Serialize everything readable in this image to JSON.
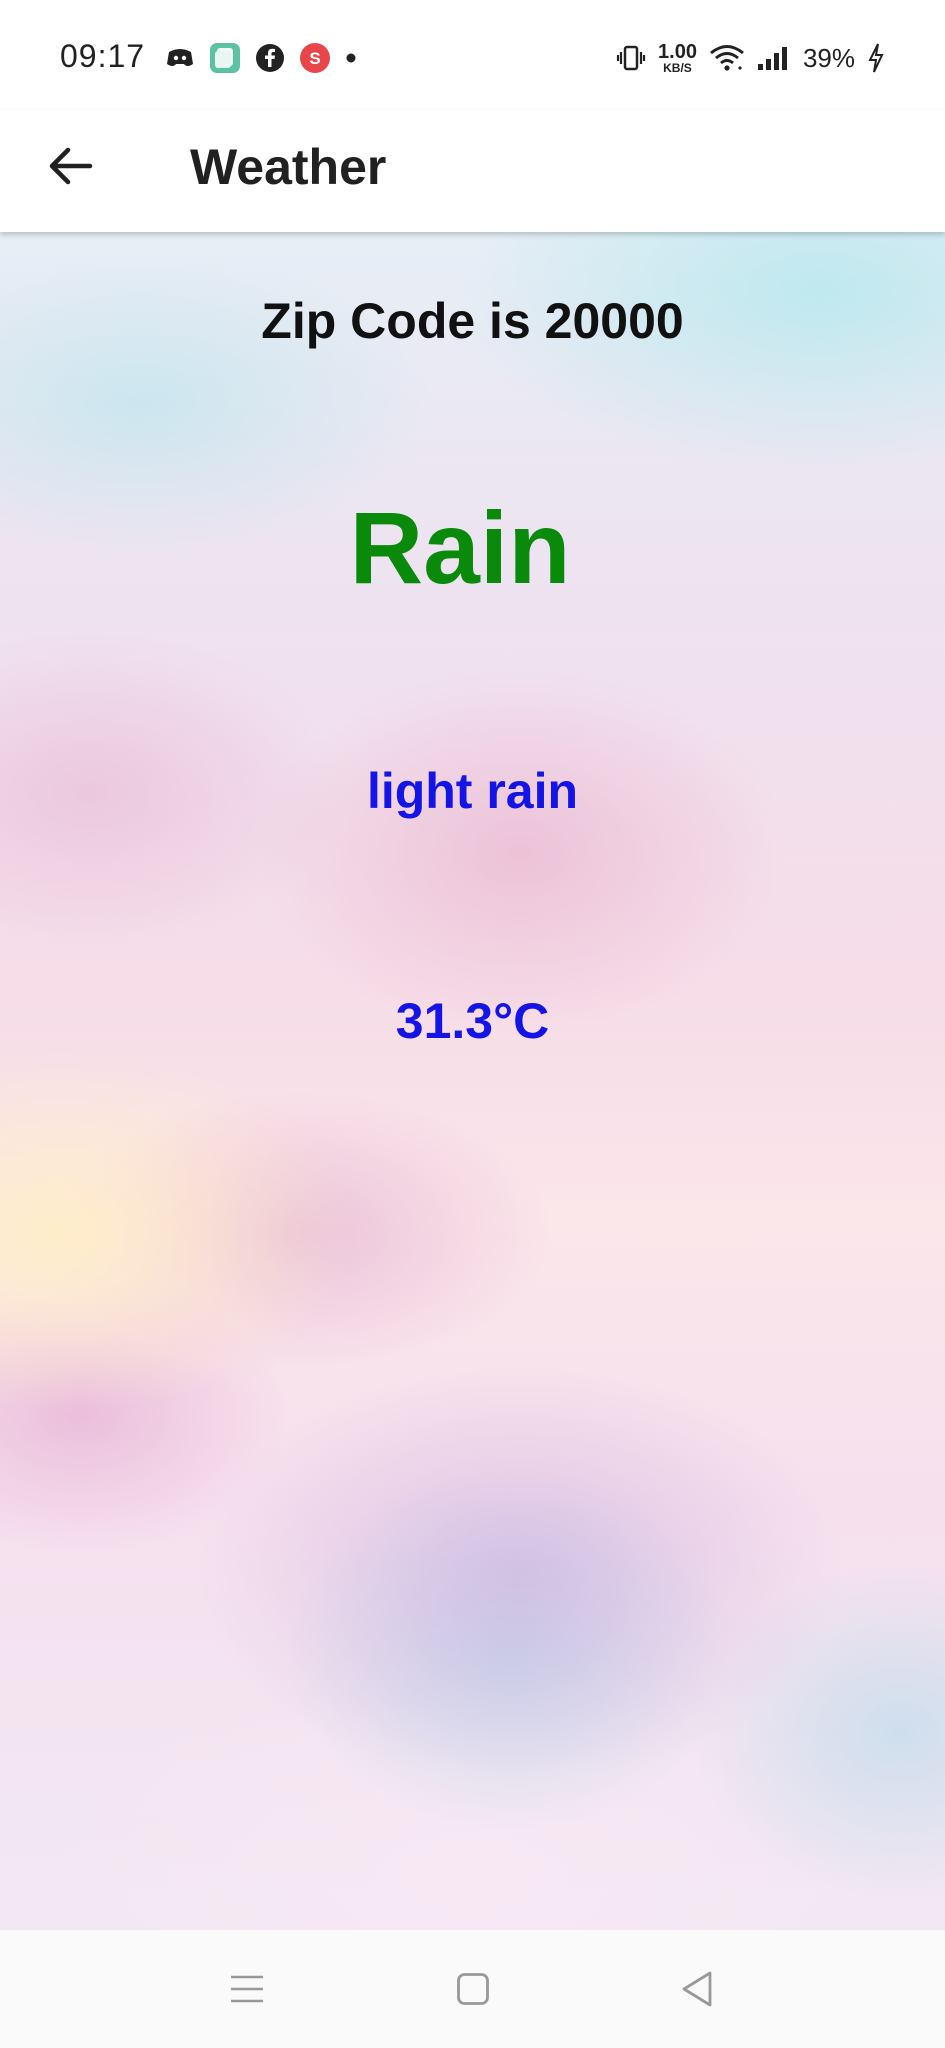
{
  "status_bar": {
    "time": "09:17",
    "left_icons": [
      "discord-icon",
      "app-icon",
      "facebook-icon",
      "s-app-icon",
      "notification-dot-icon"
    ],
    "s_app_letter": "S",
    "net_speed_value": "1.00",
    "net_speed_unit": "KB/S",
    "battery_percent": "39%",
    "right_icons": [
      "vibrate-icon",
      "wifi-icon",
      "signal-icon",
      "charging-icon"
    ]
  },
  "app_bar": {
    "back_icon": "arrow-left-icon",
    "title": "Weather"
  },
  "weather": {
    "zip_text": "Zip Code is 20000",
    "main": "Rain",
    "description": "light rain",
    "temperature": "31.3°C"
  },
  "nav_bar": {
    "icons": [
      "menu-icon",
      "home-square-icon",
      "back-triangle-icon"
    ]
  },
  "colors": {
    "main_weather": "#0a8a0a",
    "details": "#1414e6",
    "title": "#212121",
    "zip": "#111111"
  }
}
